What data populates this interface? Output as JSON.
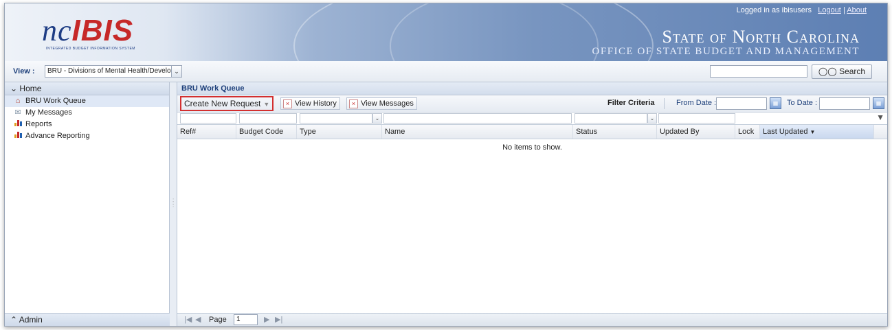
{
  "header": {
    "logo_nc": "nc",
    "logo_ibis": "IBIS",
    "logo_sub": "INTEGRATED BUDGET INFORMATION SYSTEM",
    "login_text": "Logged in as ibisusers",
    "logout_label": "Logout",
    "about_label": "About",
    "state_title": "State of North Carolina",
    "state_subtitle": "OFFICE OF STATE BUDGET AND MANAGEMENT"
  },
  "viewbar": {
    "view_label": "View :",
    "view_value": "BRU - Divisions of Mental Health/Developmental Disabilitie",
    "search_value": "",
    "search_label": "Search"
  },
  "sidebar": {
    "home_label": "Home",
    "items": [
      {
        "label": "BRU Work Queue",
        "icon": "home-icon"
      },
      {
        "label": "My Messages",
        "icon": "envelope-icon"
      },
      {
        "label": "Reports",
        "icon": "bar-chart-icon"
      },
      {
        "label": "Advance Reporting",
        "icon": "bar-chart-icon"
      }
    ],
    "admin_label": "Admin"
  },
  "main": {
    "title": "BRU Work Queue",
    "toolbar": {
      "create_label": "Create New Request",
      "history_label": "View History",
      "messages_label": "View Messages",
      "filter_criteria_label": "Filter Criteria",
      "from_date_label": "From Date :",
      "to_date_label": "To Date :"
    },
    "columns": [
      "Ref#",
      "Budget Code",
      "Type",
      "Name",
      "Status",
      "Updated By",
      "Lock",
      "Last Updated"
    ],
    "sorted_column": "Last Updated",
    "empty_message": "No items to show.",
    "pager": {
      "page_label": "Page",
      "page_value": "1"
    }
  },
  "colors": {
    "accent": "#1d3f7a",
    "highlight_border": "#d32f2f",
    "selected_row": "#dfe8f6"
  }
}
